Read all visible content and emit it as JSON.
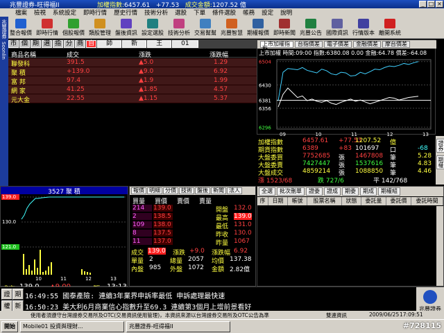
{
  "window": {
    "title": "兆豐證券-旺得福II"
  },
  "header_info": {
    "index_label": "加權指數:",
    "index_value": "6457.61",
    "change": "+77.53",
    "turnover_label": "成交金額:",
    "turnover_value": "1207.52",
    "unit": "億"
  },
  "menu": [
    "檔案",
    "檢視",
    "系統設定",
    "即時行情",
    "歷史行情",
    "技術分析",
    "選股",
    "下單",
    "條件選股",
    "帳務",
    "設定",
    "說明"
  ],
  "toolbar": [
    "整合報價",
    "即時行情",
    "個股報價",
    "類股管理",
    "盤後資訊",
    "設定選股",
    "技術分析",
    "交易幫幫",
    "兆豐智慧",
    "期權報價",
    "即時新聞",
    "兆豐公告",
    "國際資訊",
    "行情版本",
    "離開系統"
  ],
  "left_strip": [
    "兆豐證券",
    "Soonlin"
  ],
  "quote_tabs": [
    "市",
    "個",
    "期",
    "選",
    "指",
    "分",
    "商",
    "自",
    "師",
    "新",
    "王",
    "01"
  ],
  "quote_cols": {
    "name": "商品名稱",
    "price": "成交",
    "change": "漲跌",
    "pct": "漲跌幅"
  },
  "quotes": [
    {
      "name": "聯發科",
      "price": "391.5",
      "chg": "▲5.0",
      "pct": "1.29"
    },
    {
      "name": "聚 積",
      "price": "+139.0",
      "chg": "▲9.0",
      "pct": "6.92"
    },
    {
      "name": "富 邦",
      "price": "97.4",
      "chg": "▲1.9",
      "pct": "1.99"
    },
    {
      "name": "網 家",
      "price": "41.25",
      "chg": "▲1.85",
      "pct": "4.57"
    },
    {
      "name": "元大金",
      "price": "22.55",
      "chg": "▲1.15",
      "pct": "5.37"
    }
  ],
  "chart_panel": {
    "selector": "上市加權指數",
    "tabs": [
      "台指價差",
      "電子價差",
      "金融價差",
      "摩台價差"
    ],
    "info": "上市加權 時間:09:00 指數:6380.08 0.00 金融:64.78 價差:-64.08"
  },
  "chart_data": {
    "type": "line",
    "x_ticks": [
      "09",
      "10",
      "11",
      "12",
      "13"
    ],
    "y_ticks": [
      "6504",
      "6430",
      "6381",
      "6356",
      "6296"
    ],
    "ylim": [
      6290,
      6510
    ],
    "series": [
      {
        "values": [
          6380,
          6470,
          6482,
          6480,
          6478,
          6485,
          6476,
          6472,
          6468,
          6480,
          6475,
          6465,
          6462,
          6470,
          6468,
          6458,
          6460,
          6470,
          6465,
          6472,
          6480,
          6478,
          6485,
          6490,
          6488,
          6492,
          6498,
          6495,
          6500,
          6504
        ]
      },
      {
        "values": [
          6360,
          6400,
          6420,
          6405,
          6390,
          6395,
          6380,
          6385,
          6378,
          6375,
          6380,
          6372,
          6368,
          6375,
          6380,
          6385,
          6378,
          6382,
          6376,
          6370,
          6375,
          6380,
          6385,
          6390,
          6388,
          6382,
          6386,
          6390,
          6392,
          6394
        ]
      }
    ]
  },
  "market": [
    {
      "a": "加權指數",
      "b": "6457.61",
      "c": "+77.53",
      "d": "1207.52",
      "e": "億"
    },
    {
      "a": "期貨指數",
      "b": "6389",
      "c": "+83",
      "d": "101697",
      "e": "口",
      "f": "-68"
    },
    {
      "a": "大盤委買",
      "b": "7752685",
      "c": "張",
      "d": "1467808",
      "e": "筆",
      "f": "5.28"
    },
    {
      "a": "大盤委賣",
      "b": "7427447",
      "c": "張",
      "d": "1537616",
      "e": "筆",
      "f": "4.83"
    },
    {
      "a": "大盤成交",
      "b": "4859214",
      "c": "張",
      "d": "1088850",
      "e": "筆",
      "f": "4.46"
    },
    {
      "a": "漲 1523/68",
      "b": "跌 727/6",
      "c": "平 142/768"
    }
  ],
  "market_side_tabs": [
    "證券",
    "期權"
  ],
  "intraday": {
    "title": "3527 聚 積",
    "y_ticks": [
      "139.0",
      "130.0",
      "121.0"
    ],
    "x_ticks": [
      "10",
      "11",
      "12",
      "13"
    ],
    "foot_label": "成交",
    "foot_price": "139.0",
    "foot_chg": "▲9.00",
    "foot_vol": "1張",
    "foot_time": "13:13"
  },
  "fivelvl": {
    "tabs": [
      "報價",
      "明細",
      "分價",
      "技術",
      "盤後",
      "新聞",
      "法人"
    ],
    "cols": [
      "買量",
      "買價",
      "賣價",
      "賣量"
    ],
    "rows": [
      {
        "bq": "214",
        "bp": "139.0",
        "sp": "",
        "sq": "",
        "lbl": "開盤",
        "val": "132.0"
      },
      {
        "bq": "2",
        "bp": "138.5",
        "sp": "",
        "sq": "",
        "lbl": "最高",
        "val": "139.0"
      },
      {
        "bq": "109",
        "bp": "138.0",
        "sp": "",
        "sq": "",
        "lbl": "最低",
        "val": "131.0"
      },
      {
        "bq": "8",
        "bp": "137.5",
        "sp": "",
        "sq": "",
        "lbl": "昨收",
        "val": "130.0"
      },
      {
        "bq": "11",
        "bp": "137.0",
        "sp": "",
        "sq": "",
        "lbl": "昨量",
        "val": "1067"
      }
    ],
    "trade": {
      "l1": "成交",
      "v1": "139.0",
      "l2": "漲跌",
      "v2": "+9.0",
      "l3": "漲跌幅",
      "v3": "6.92"
    },
    "stats": [
      {
        "l": "單量",
        "v": "2",
        "l2": "總量",
        "v2": "2057",
        "l3": "均價",
        "v3": "137.38"
      },
      {
        "l": "內盤",
        "v": "985",
        "l2": "外盤",
        "v2": "1072",
        "l3": "金額",
        "v3": "2.82億"
      }
    ]
  },
  "orders": {
    "tabs": [
      "全選",
      "批次刪單",
      "證委",
      "證成",
      "期委",
      "期成",
      "期權組"
    ],
    "cols": [
      "序",
      "日期",
      "帳號",
      "股票名稱",
      "狀態",
      "委託量",
      "委託價",
      "委託時間"
    ]
  },
  "news": {
    "buttons": [
      "證",
      "期",
      "權",
      "新"
    ],
    "lines": [
      "16:49:55 國泰產險: 連續3年業界申訴率最低 申訴處理最快速",
      "16:50:23 美大利6月商業信心指數升至69.3 連續第3個月上增前景看好"
    ],
    "logo": "兆豐證券"
  },
  "status": {
    "text": "使用者須遵守台灣證券交易所及OTC(交易資訊使用管理)，本資訊來源以台灣證券交易所及OTC公告為準",
    "service": "雙連資訊",
    "date": "2009/06/25",
    "time": "17:09:51"
  },
  "taskbar": [
    "開始",
    "Mobile01 投資與理財...",
    "兆豐證券-旺得福II"
  ],
  "watermark": "#728115"
}
